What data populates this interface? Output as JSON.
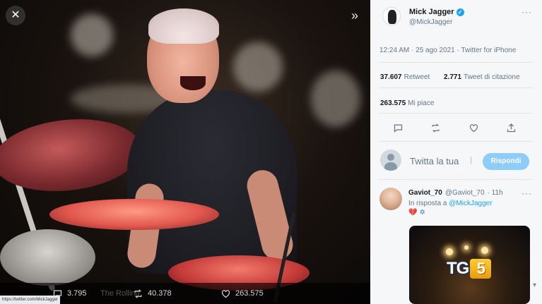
{
  "media": {
    "close_icon": "close-icon",
    "expand_icon": "chevron-right-icon",
    "actions": {
      "replies": "3.795",
      "retweets": "40.378",
      "likes": "263.575",
      "ghost_text": "The Rolling"
    },
    "status_url": "https://twitter.com/MickJagger"
  },
  "tweet": {
    "author_name": "Mick Jagger",
    "author_handle": "@MickJagger",
    "timestamp": "12:24 AM · 25 ago 2021 · Twitter for iPhone",
    "retweets_count": "37.607",
    "retweets_label": "Retweet",
    "quote_count": "2.771",
    "quote_label": "Tweet di citazione",
    "likes_count": "263.575",
    "likes_label": "Mi piace",
    "more": "···"
  },
  "reply_box": {
    "placeholder": "Twitta la tua",
    "button": "Rispondi"
  },
  "reply": {
    "name": "Gaviot_70",
    "handle": "@Gaviot_70",
    "time": "· 11h",
    "in_reply_to": "In risposta a",
    "mention": "@MickJagger",
    "emoji": "💔",
    "flag": "✡"
  },
  "watermark": {
    "tg": "TG",
    "five": "5"
  },
  "colors": {
    "accent": "#1da1f2",
    "reply_button": "#8ecdf8",
    "panel_bg": "#f5f7f9"
  }
}
